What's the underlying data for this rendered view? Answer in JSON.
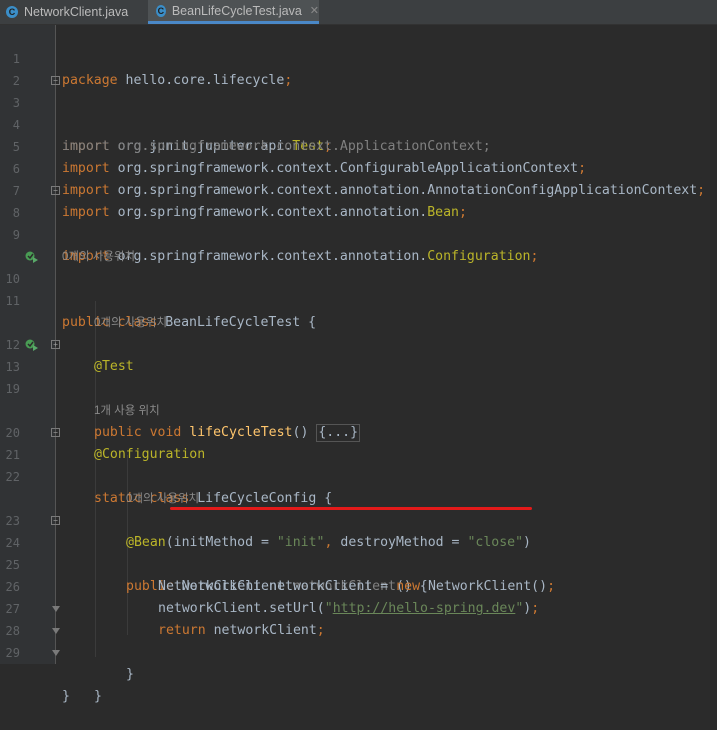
{
  "tabs": [
    {
      "label": "NetworkClient.java",
      "icon": "class-icon",
      "active": false
    },
    {
      "label": "BeanLifeCycleTest.java",
      "icon": "class-icon",
      "active": true
    }
  ],
  "lines": {
    "l1": {
      "n": "1",
      "kw": "package",
      "rest": " hello.core.lifecycle",
      "semi": ";"
    },
    "l2": {
      "n": "2"
    },
    "l3": {
      "n": "3",
      "kw": "import",
      "pkg": " org.junit.jupiter.api.",
      "cls": "Test",
      "semi": ";"
    },
    "l4": {
      "n": "4",
      "text": "import org.springframework.context.ApplicationContext;"
    },
    "l5": {
      "n": "5",
      "kw": "import",
      "pkg": " org.springframework.context.ConfigurableApplicationContext",
      "semi": ";"
    },
    "l6": {
      "n": "6",
      "kw": "import",
      "pkg": " org.springframework.context.annotation.AnnotationConfigApplicationContext",
      "semi": ";"
    },
    "l7": {
      "n": "7",
      "kw": "import",
      "pkg": " org.springframework.context.annotation.",
      "cls": "Bean",
      "semi": ";"
    },
    "l8": {
      "n": "8",
      "kw": "import",
      "pkg": " org.springframework.context.annotation.",
      "cls": "Configuration",
      "semi": ";"
    },
    "l9": {
      "n": "9"
    },
    "hint1": "0개의 사용위치",
    "l10": {
      "n": "10",
      "kw": "public class",
      "rest": " BeanLifeCycleTest {"
    },
    "l11": {
      "n": "11"
    },
    "hint2": "0개의 사용위치",
    "l12": {
      "n": "12",
      "ann": "@Test"
    },
    "l13": {
      "n": "13",
      "kw": "public void",
      "fn": " lifeCycleTest",
      "paren": "() ",
      "folded": "{...}"
    },
    "l19": {
      "n": "19"
    },
    "hint3": "1개 사용 위치",
    "l20": {
      "n": "20",
      "ann": "@Configuration"
    },
    "l21": {
      "n": "21",
      "kw": "static class",
      "rest": " LifeCycleConfig {"
    },
    "l22": {
      "n": "22"
    },
    "hint4": "0개의 사용위치",
    "l23": {
      "n": "23",
      "ann": "@Bean",
      "p1": "(initMethod = ",
      "s1": "\"init\"",
      "comma": ", ",
      "p2": "destroyMethod = ",
      "s2": "\"close\"",
      "p3": ")"
    },
    "l24": {
      "n": "24",
      "kw": "public",
      "type": " NetworkClient ",
      "dim": "networkClient",
      "rest": "() {"
    },
    "l25": {
      "n": "25",
      "a": "NetworkClient networkClient = ",
      "kw": "new",
      "b": " NetworkClient()",
      "semi": ";"
    },
    "l26": {
      "n": "26",
      "a": "networkClient.setUrl(",
      "q1": "\"",
      "url": "http://hello-spring.dev",
      "q2": "\"",
      "b": ")",
      "semi": ";"
    },
    "l27": {
      "n": "27",
      "kw": "return",
      "b": " networkClient",
      "semi": ";"
    },
    "l28": {
      "n": "28",
      "text": "}"
    },
    "l29": {
      "n": "29",
      "text": "}"
    },
    "l30": {
      "text": "}"
    }
  },
  "colors": {
    "keyword": "#cc7832",
    "annotation": "#bbb529",
    "string": "#6a8759",
    "method": "#ffc66d",
    "text": "#a9b7c6",
    "highlight": "#e31a1a"
  }
}
